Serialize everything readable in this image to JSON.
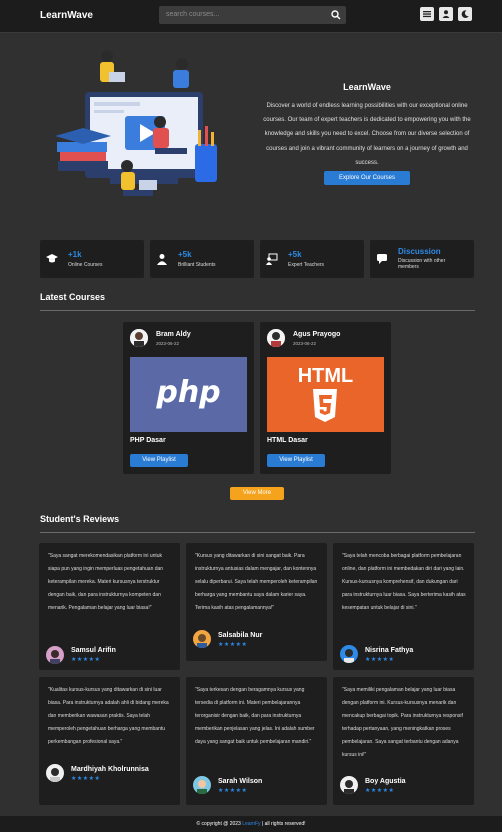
{
  "header": {
    "logo": "LearnWave",
    "search_placeholder": "search courses...",
    "icons": [
      "search-icon",
      "menu-icon",
      "user-icon",
      "moon-icon"
    ]
  },
  "hero": {
    "title": "LearnWave",
    "description": "Discover a world of endless learning possibilities with our exceptional online courses. Our team of expert teachers is dedicated to empowering you with the knowledge and skills you need to excel. Choose from our diverse selection of courses and join a vibrant community of learners on a journey of growth and success.",
    "button": "Explore Our Courses"
  },
  "stats": [
    {
      "icon": "graduation-cap-icon",
      "number": "+1k",
      "label": "Online Courses"
    },
    {
      "icon": "student-icon",
      "number": "+5k",
      "label": "Brilliant Students"
    },
    {
      "icon": "teacher-icon",
      "number": "+5k",
      "label": "Expert Teachers"
    },
    {
      "icon": "chat-icon",
      "number": "Discussion",
      "label": "Discussion with other members"
    }
  ],
  "latest": {
    "heading": "Latest Courses",
    "courses": [
      {
        "author": "Bram Aldy",
        "date": "2023-06-22",
        "thumb_text": "php",
        "title": "PHP Dasar",
        "button": "View Playlist"
      },
      {
        "author": "Agus Prayogo",
        "date": "2023-06-22",
        "thumb_text": "HTML",
        "title": "HTML Dasar",
        "button": "View Playlist"
      }
    ],
    "view_more": "View More"
  },
  "reviews": {
    "heading": "Student's Reviews",
    "stars": "★★★★★",
    "items": [
      {
        "quote": "\"Saya sangat merekomendasikan platform ini untuk siapa pun yang ingin memperluas pengetahuan dan keterampilan mereka. Materi kursusnya terstruktur dengan baik, dan para instrukturnya kompeten dan menarik. Pengalaman belajar yang luar biasa!\"",
        "name": "Samsul Arifin"
      },
      {
        "quote": "\"Kursus yang ditawarkan di sini sangat baik. Para instrukturnya antusias dalam mengajar, dan kontennya selalu diperbarui. Saya telah memperoleh keterampilan berharga yang membantu saya dalam karier saya. Terima kasih atas pengalamannya!\"",
        "name": "Salsabila Nur"
      },
      {
        "quote": "\"Saya telah mencoba berbagai platform pembelajaran online, dan platform ini membedakan diri dari yang lain. Kursus-kursusnya komprehensif, dan dukungan dari para instrukturnya luar biasa. Saya berterima kasih atas kesempatan untuk belajar di sini.\"",
        "name": "Nisrina Fathya"
      },
      {
        "quote": "\"Kualitas kursus-kursus yang ditawarkan di sini luar biasa. Para instrukturnya adalah ahli di bidang mereka dan memberikan wawasan praktis. Saya telah memperoleh pengetahuan berharga yang membantu perkembangan profesional saya.\"",
        "name": "Mardhiyah Kholrunnisa"
      },
      {
        "quote": "\"Saya terkesan dengan beragamnya kursus yang tersedia di platform ini. Materi pembelajarannya terorganisir dengan baik, dan para instrukturnya memberikan penjelasan yang jelas. Ini adalah sumber daya yang sangat baik untuk pembelajaran mandiri.\"",
        "name": "Sarah Wilson"
      },
      {
        "quote": "\"Saya memiliki pengalaman belajar yang luar biasa dengan platform ini. Kursus-kursusnya menarik dan mencakup berbagai topik. Para instrukturnya responsif terhadap pertanyaan, yang meningkatkan proses pembelajaran. Saya sangat terbantu dengan adanya kursus ini!\"",
        "name": "Boy Agustia"
      }
    ]
  },
  "footer": {
    "prefix": "© copyright @ 2023",
    "brand": "LearnFy",
    "suffix": "| all rights reserved!"
  },
  "colors": {
    "accent": "#2a7bd4",
    "warn": "#f5a21c",
    "bg": "#303030",
    "card": "#1e1e1e"
  }
}
